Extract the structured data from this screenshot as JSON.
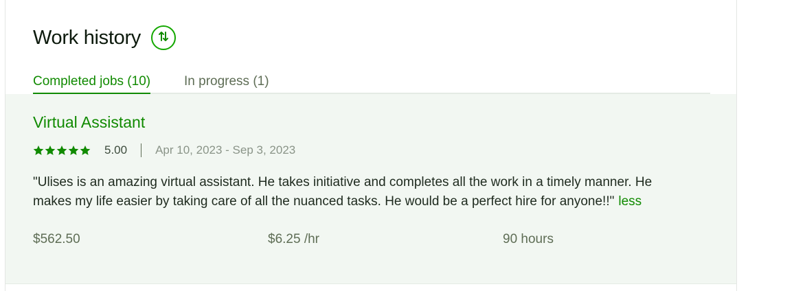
{
  "section": {
    "title": "Work history",
    "sort_icon": "sort-arrows-icon"
  },
  "tabs": [
    {
      "label": "Completed jobs (10)",
      "active": true
    },
    {
      "label": "In progress (1)",
      "active": false
    }
  ],
  "job": {
    "title": "Virtual Assistant",
    "rating": 5,
    "rating_text": "5.00",
    "dates": "Apr 10, 2023 - Sep 3, 2023",
    "review": "\"Ulises is an amazing virtual assistant. He takes initiative and completes all the work in a timely manner. He makes my life easier by taking care of all the nuanced tasks. He would be a perfect hire for anyone!!\"",
    "less_label": "less",
    "earnings": "$562.50",
    "rate": "$6.25 /hr",
    "hours": "90 hours"
  },
  "colors": {
    "accent": "#108a00",
    "job_background": "#f2f7f2"
  }
}
